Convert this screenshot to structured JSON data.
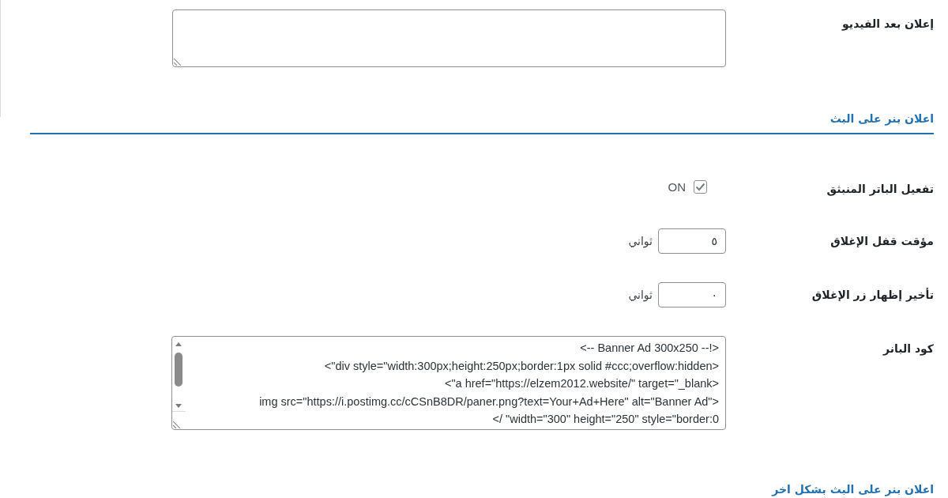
{
  "rows": [
    {
      "kind": "textarea",
      "label": "إعلان بعد الفيديو"
    }
  ],
  "sections": [
    {
      "title": "اعلان بنر على البث",
      "rows": [
        {
          "kind": "checkbox",
          "label": "تفعيل الباتر المنبثق",
          "checked": true,
          "text": "ON"
        },
        {
          "kind": "number",
          "label": "مؤقت قفل الإغلاق",
          "value": "٥",
          "unit": "ثواني"
        },
        {
          "kind": "number",
          "label": "تأخير إظهار زر الإغلاق",
          "value": "٠",
          "unit": "ثواني"
        },
        {
          "kind": "code",
          "label": "كود البانر",
          "lines": [
            "<-- Banner Ad 300x250 --!>",
            "<\"div style=\"width:300px;height:250px;border:1px solid #ccc;overflow:hidden>",
            "<\"a href=\"https://elzem2012.website/\" target=\"_blank>",
            "img src=\"https://i.postimg.cc/cCSnB8DR/paner.png?text=Your+Ad+Here\" alt=\"Banner Ad\">",
            "</ \"width=\"300\" height=\"250\" style=\"border:0"
          ]
        }
      ]
    },
    {
      "title": "اعلان بنر على البث بشكل اخر"
    }
  ]
}
